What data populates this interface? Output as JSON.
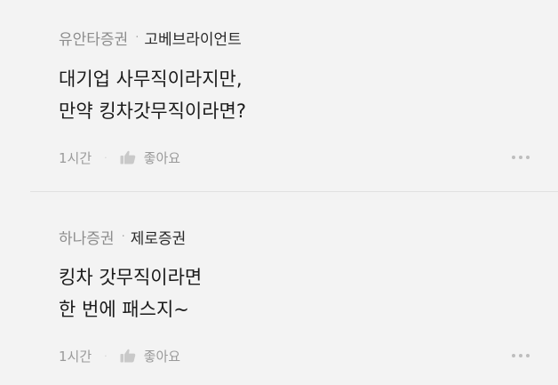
{
  "comments": [
    {
      "author": "유안타증권",
      "separator": "·",
      "company": "고베브라이언트",
      "lines": [
        "대기업 사무직이라지만,",
        "만약 킹차갓무직이라면?"
      ],
      "time": "1시간",
      "footer_separator": "·",
      "like_label": "좋아요",
      "like_icon": "thumbs-up-icon",
      "more_icon": "more-dots-icon"
    },
    {
      "author": "하나증권",
      "separator": "·",
      "company": "제로증권",
      "lines": [
        "킹차 갓무직이라면",
        "한 번에 패스지~"
      ],
      "time": "1시간",
      "footer_separator": "·",
      "like_label": "좋아요",
      "like_icon": "thumbs-up-icon",
      "more_icon": "more-dots-icon"
    }
  ],
  "colors": {
    "background": "#f3f3f3",
    "author": "#8d8d8d",
    "company": "#2a2a2a",
    "body": "#1b1b1b",
    "muted": "#9a9a9a",
    "divider": "#e0e0e0"
  }
}
